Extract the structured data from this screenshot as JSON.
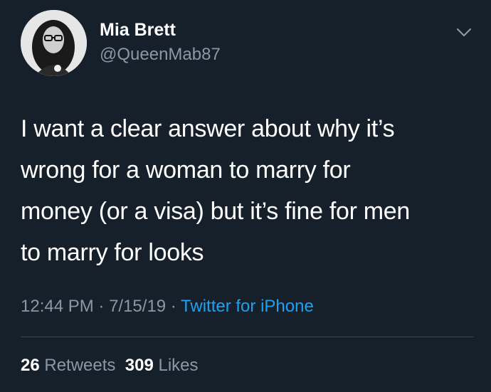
{
  "user": {
    "display_name": "Mia Brett",
    "handle": "@QueenMab87",
    "avatar_icon": "profile-photo"
  },
  "menu": {
    "icon": "chevron-down-icon"
  },
  "tweet": {
    "lines": [
      "I want a clear answer about why it’s",
      "wrong for a woman to marry for",
      "money (or a visa) but it’s fine for men",
      "to marry for looks"
    ]
  },
  "meta": {
    "time": "12:44 PM",
    "sep1": " · ",
    "date": "7/15/19",
    "sep2": " · ",
    "source": "Twitter for iPhone"
  },
  "stats": {
    "retweets_count": "26",
    "retweets_label": "Retweets",
    "likes_count": "309",
    "likes_label": "Likes"
  },
  "colors": {
    "background": "#15202b",
    "text": "#ffffff",
    "secondary": "#8899a6",
    "accent": "#1da1f2",
    "divider": "#38444d"
  }
}
